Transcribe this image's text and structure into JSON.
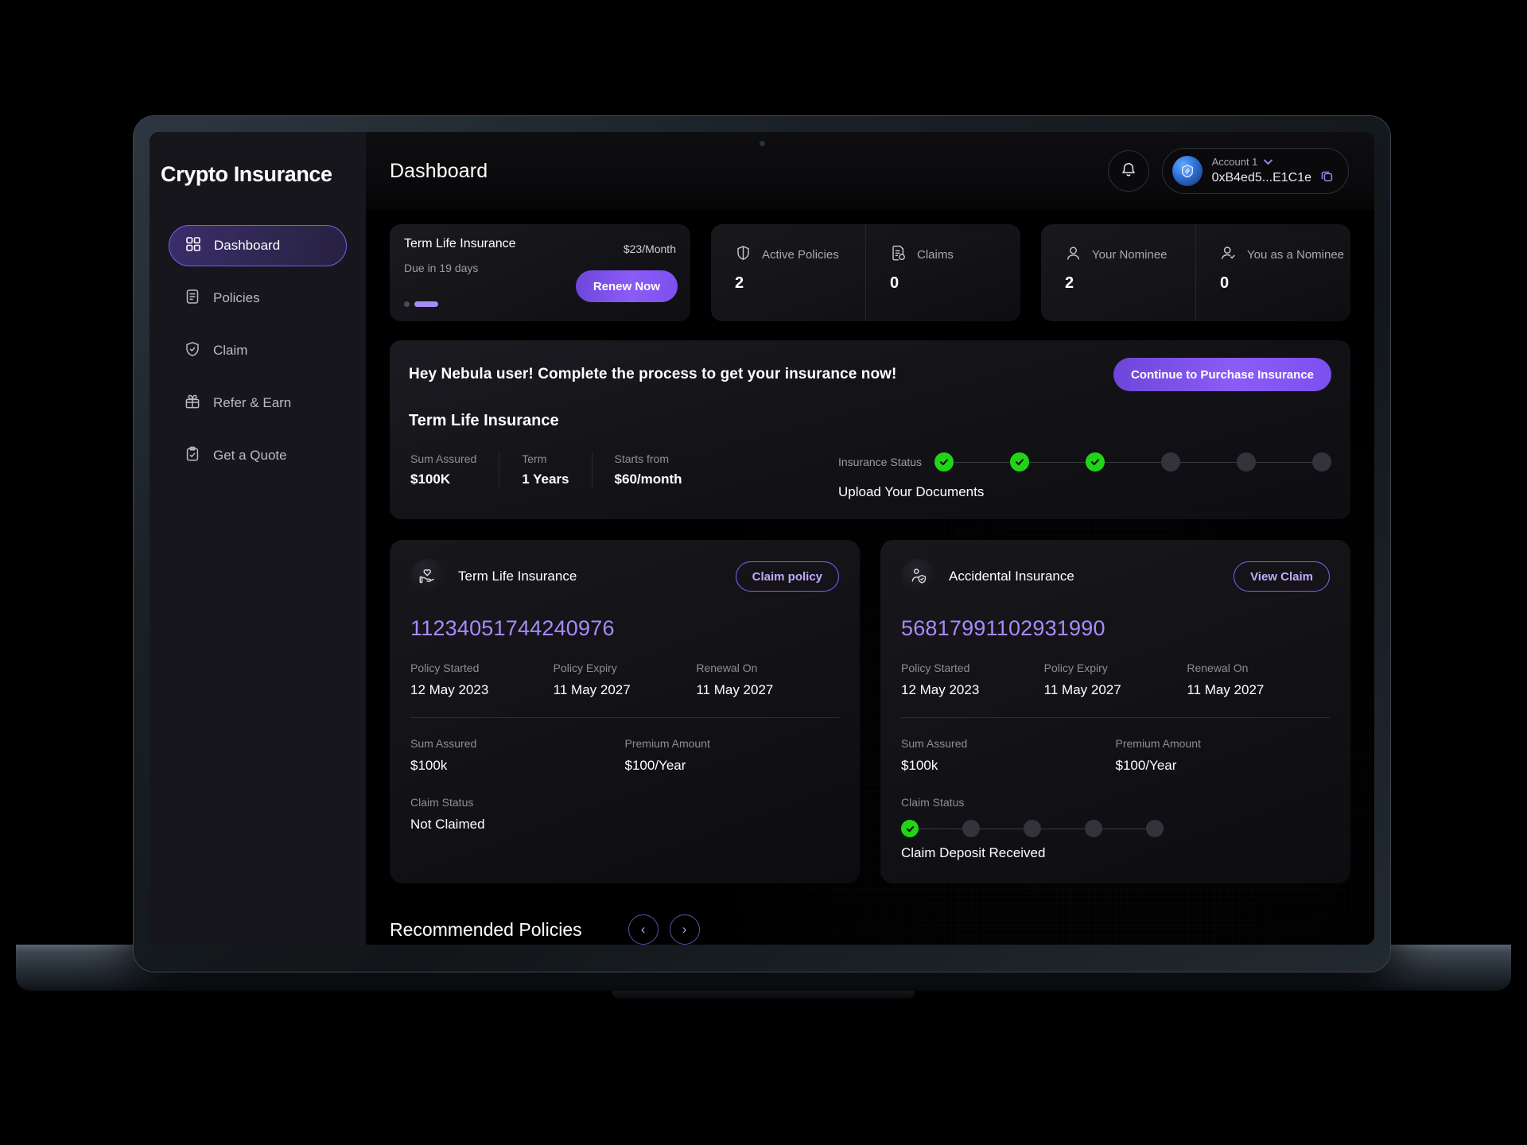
{
  "sidebar": {
    "brand": "Crypto Insurance",
    "items": [
      {
        "label": "Dashboard",
        "icon": "grid-icon",
        "active": true
      },
      {
        "label": "Policies",
        "icon": "document-icon",
        "active": false
      },
      {
        "label": "Claim",
        "icon": "shield-check-icon",
        "active": false
      },
      {
        "label": "Refer & Earn",
        "icon": "gift-icon",
        "active": false
      },
      {
        "label": "Get a Quote",
        "icon": "clipboard-check-icon",
        "active": false
      }
    ]
  },
  "topbar": {
    "title": "Dashboard",
    "bell_icon": "bell-icon",
    "account": {
      "name": "Account 1",
      "address": "0xB4ed5...E1C1e",
      "chevron_icon": "chevron-down-icon",
      "copy_icon": "copy-icon"
    }
  },
  "renew_card": {
    "title": "Term Life Insurance",
    "price": "$23",
    "price_unit": "/Month",
    "due": "Due in 19 days",
    "button": "Renew Now"
  },
  "stats": [
    {
      "label": "Active Policies",
      "value": "2",
      "icon": "shield-icon"
    },
    {
      "label": "Claims",
      "value": "0",
      "icon": "claim-doc-icon"
    },
    {
      "label": "Your Nominee",
      "value": "2",
      "icon": "user-icon"
    },
    {
      "label": "You as a Nominee",
      "value": "0",
      "icon": "user-check-icon"
    }
  ],
  "purchase_banner": {
    "headline": "Hey Nebula user! Complete the process to get your insurance now!",
    "cta": "Continue to Purchase Insurance",
    "subtitle": "Term Life Insurance",
    "facts": [
      {
        "label": "Sum Assured",
        "value": "$100K"
      },
      {
        "label": "Term",
        "value": "1 Years"
      },
      {
        "label": "Starts from",
        "value": "$60/month"
      }
    ],
    "status_label": "Insurance Status",
    "status_text": "Upload Your Documents",
    "steps_total": 6,
    "steps_done": 3
  },
  "policies": [
    {
      "name": "Term Life Insurance",
      "icon": "hand-heart-icon",
      "action": "Claim policy",
      "number": "11234051744240976",
      "dates": [
        {
          "label": "Policy Started",
          "value": "12 May 2023"
        },
        {
          "label": "Policy Expiry",
          "value": "11 May 2027"
        },
        {
          "label": "Renewal On",
          "value": "11 May 2027"
        }
      ],
      "amounts": [
        {
          "label": "Sum Assured",
          "value": "$100k"
        },
        {
          "label": "Premium Amount",
          "value": "$100/Year"
        }
      ],
      "claim_label": "Claim Status",
      "claim_value": "Not Claimed",
      "has_claim_steps": false,
      "claim_steps_total": 0,
      "claim_steps_done": 0
    },
    {
      "name": "Accidental Insurance",
      "icon": "person-shield-icon",
      "action": "View Claim",
      "number": "56817991102931990",
      "dates": [
        {
          "label": "Policy Started",
          "value": "12 May 2023"
        },
        {
          "label": "Policy Expiry",
          "value": "11 May 2027"
        },
        {
          "label": "Renewal On",
          "value": "11 May 2027"
        }
      ],
      "amounts": [
        {
          "label": "Sum Assured",
          "value": "$100k"
        },
        {
          "label": "Premium Amount",
          "value": "$100/Year"
        }
      ],
      "claim_label": "Claim Status",
      "claim_value": "Claim Deposit Received",
      "has_claim_steps": true,
      "claim_steps_total": 5,
      "claim_steps_done": 1
    }
  ],
  "recommended": {
    "title": "Recommended Policies",
    "prev_icon": "chevron-left-icon",
    "next_icon": "chevron-right-icon",
    "prev_glyph": "‹",
    "next_glyph": "›"
  },
  "colors": {
    "accent": "#8b5cf6",
    "accent_text": "#a78bfa",
    "success": "#22d417",
    "sidebar_bg": "#17161d",
    "card_bg": "#131316"
  }
}
